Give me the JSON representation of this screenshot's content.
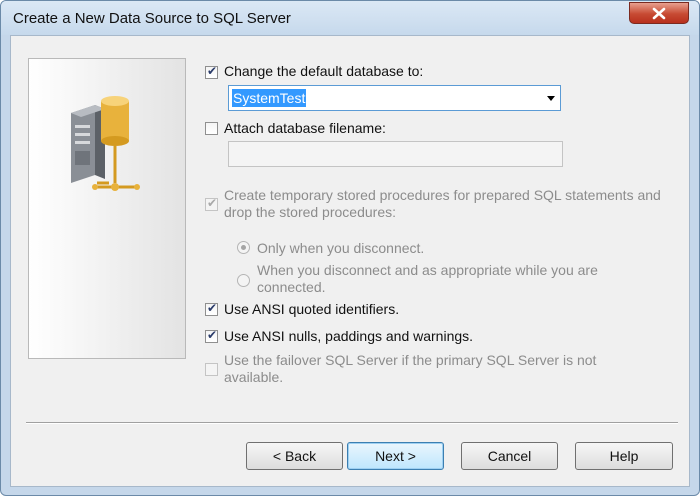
{
  "window": {
    "title": "Create a New Data Source to SQL Server"
  },
  "options": {
    "change_db": {
      "label": "Change the default database to:",
      "checked": true
    },
    "database": {
      "value": "SystemTest"
    },
    "attach_db": {
      "label": "Attach database filename:",
      "checked": false
    },
    "filename": {
      "value": ""
    },
    "temp_procs": {
      "label": "Create temporary stored procedures for prepared SQL statements and drop the stored procedures:",
      "checked": true,
      "enabled": false
    },
    "radio_disconnect": {
      "label": "Only when you disconnect.",
      "selected": true
    },
    "radio_appropriate": {
      "label": "When you disconnect and as appropriate while you are connected.",
      "selected": false
    },
    "ansi_quoted": {
      "label": "Use ANSI quoted identifiers.",
      "checked": true
    },
    "ansi_nulls": {
      "label": "Use ANSI nulls, paddings and warnings.",
      "checked": true
    },
    "failover": {
      "label": "Use the failover SQL Server if the primary SQL Server is not available.",
      "checked": false,
      "enabled": false
    }
  },
  "buttons": {
    "back": "< Back",
    "next": "Next >",
    "cancel": "Cancel",
    "help": "Help"
  },
  "colors": {
    "accent": "#3399ff",
    "close": "#c74a33"
  }
}
